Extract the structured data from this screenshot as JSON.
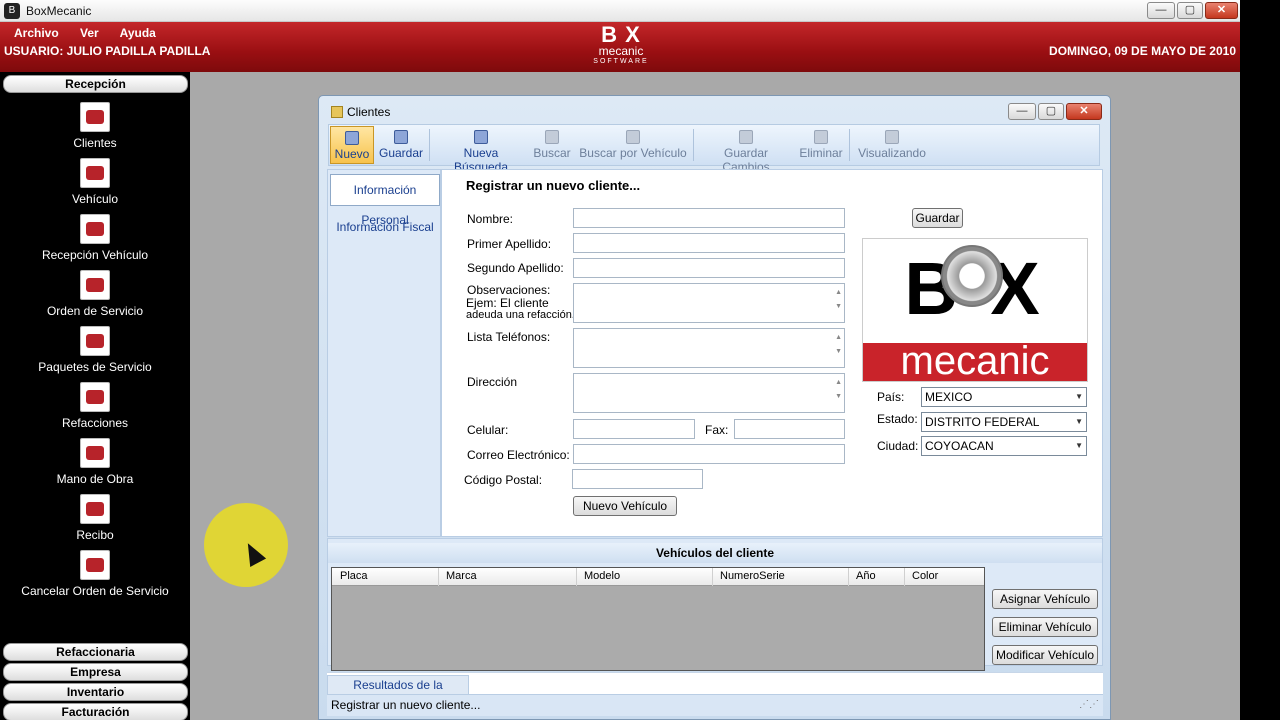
{
  "window": {
    "title": "BoxMecanic",
    "min": "—",
    "max": "▢",
    "close": "✕"
  },
  "menu": [
    "Archivo",
    "Ver",
    "Ayuda"
  ],
  "header": {
    "user": "USUARIO: JULIO PADILLA PADILLA",
    "date": "DOMINGO, 09 DE MAYO DE 2010",
    "logo": {
      "l1": "B X",
      "l2": "mecanic",
      "l3": "SOFTWARE"
    }
  },
  "sidebar": {
    "section_top": "Recepción",
    "items": [
      "Clientes",
      "Vehículo",
      "Recepción Vehículo",
      "Orden de Servicio",
      "Paquetes de Servicio",
      "Refacciones",
      "Mano de Obra",
      "Recibo",
      "Cancelar Orden de Servicio"
    ],
    "sections_bottom": [
      "Refaccionaria",
      "Empresa",
      "Inventario",
      "Facturación"
    ]
  },
  "clientes": {
    "title": "Clientes",
    "toolbar": [
      {
        "label": "Nuevo",
        "state": "active"
      },
      {
        "label": "Guardar",
        "state": "enabled"
      },
      {
        "label": "Nueva Búsqueda",
        "state": "enabled"
      },
      {
        "label": "Buscar",
        "state": "disabled"
      },
      {
        "label": "Buscar por Vehículo",
        "state": "disabled"
      },
      {
        "label": "Guardar Cambios",
        "state": "disabled"
      },
      {
        "label": "Eliminar",
        "state": "disabled"
      },
      {
        "label": "Visualizando",
        "state": "disabled"
      }
    ],
    "tabs": [
      "Información Personal",
      "Información Fiscal"
    ],
    "form": {
      "heading": "Registrar un nuevo cliente...",
      "labels": {
        "nombre": "Nombre:",
        "primer_apellido": "Primer Apellido:",
        "segundo_apellido": "Segundo Apellido:",
        "observaciones": "Observaciones:",
        "observaciones_hint1": "Ejem: El cliente",
        "observaciones_hint2": "adeuda una refacción.",
        "telefonos": "Lista Teléfonos:",
        "direccion": "Dirección",
        "celular": "Celular:",
        "fax": "Fax:",
        "correo": "Correo Electrónico:",
        "cp": "Código Postal:",
        "pais": "País:",
        "estado": "Estado:",
        "ciudad": "Ciudad:"
      },
      "values": {
        "pais": "MEXICO",
        "estado": "DISTRITO FEDERAL",
        "ciudad": "COYOACAN"
      },
      "buttons": {
        "guardar": "Guardar",
        "nuevo_vehiculo": "Nuevo Vehículo"
      },
      "logo": {
        "top": "B X",
        "bottom": "mecanic"
      }
    },
    "vehiculos": {
      "title": "Vehículos del cliente",
      "columns": [
        "Placa",
        "Marca",
        "Modelo",
        "NumeroSerie",
        "Año",
        "Color"
      ],
      "buttons": [
        "Asignar Vehículo",
        "Eliminar Vehículo",
        "Modificar Vehículo"
      ]
    },
    "bottom_tab": "Resultados de la búsqueda",
    "status": "Registrar un nuevo cliente..."
  }
}
